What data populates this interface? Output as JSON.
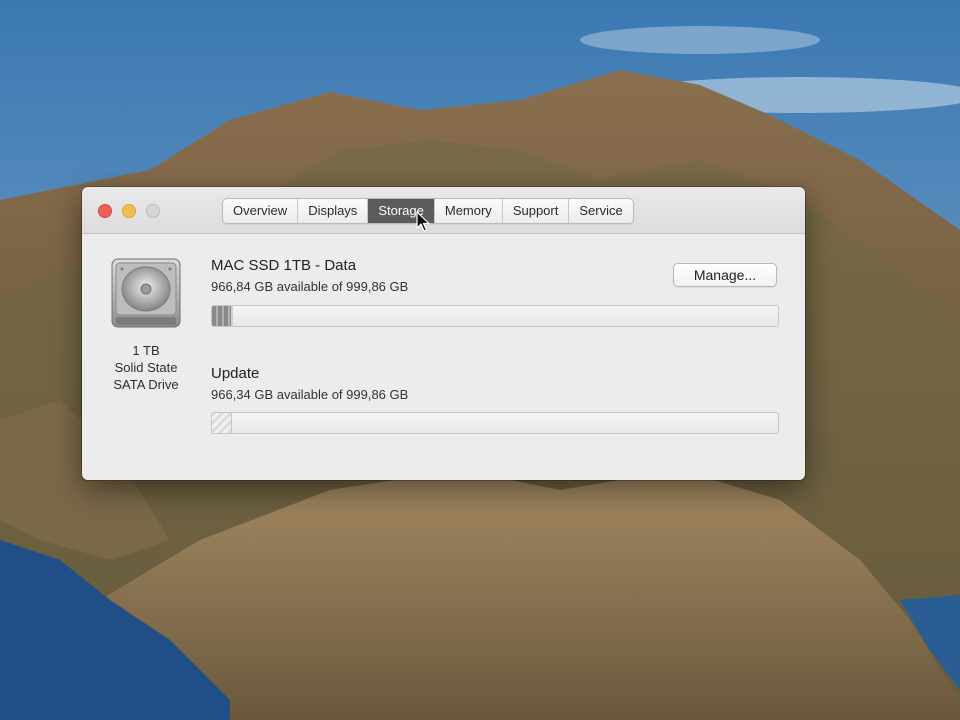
{
  "window": {
    "tabs": [
      {
        "label": "Overview"
      },
      {
        "label": "Displays"
      },
      {
        "label": "Storage"
      },
      {
        "label": "Memory"
      },
      {
        "label": "Support"
      },
      {
        "label": "Service"
      }
    ],
    "active_tab": "Storage"
  },
  "drive": {
    "icon": "hard-drive-icon",
    "caption_lines": [
      "1 TB",
      "Solid State",
      "SATA Drive"
    ]
  },
  "volumes": [
    {
      "name": "MAC SSD 1TB - Data",
      "available": "966,84 GB available of 999,86 GB",
      "used_fraction": 0.033
    },
    {
      "name": "Update",
      "available": "966,34 GB available of 999,86 GB",
      "used_fraction": 0.034
    }
  ],
  "buttons": {
    "manage": "Manage..."
  },
  "colors": {
    "close": "#ee5f57",
    "minimize": "#f4bd4f",
    "zoom": "#d6d6d6",
    "active_tab": "#5b5b5b"
  }
}
